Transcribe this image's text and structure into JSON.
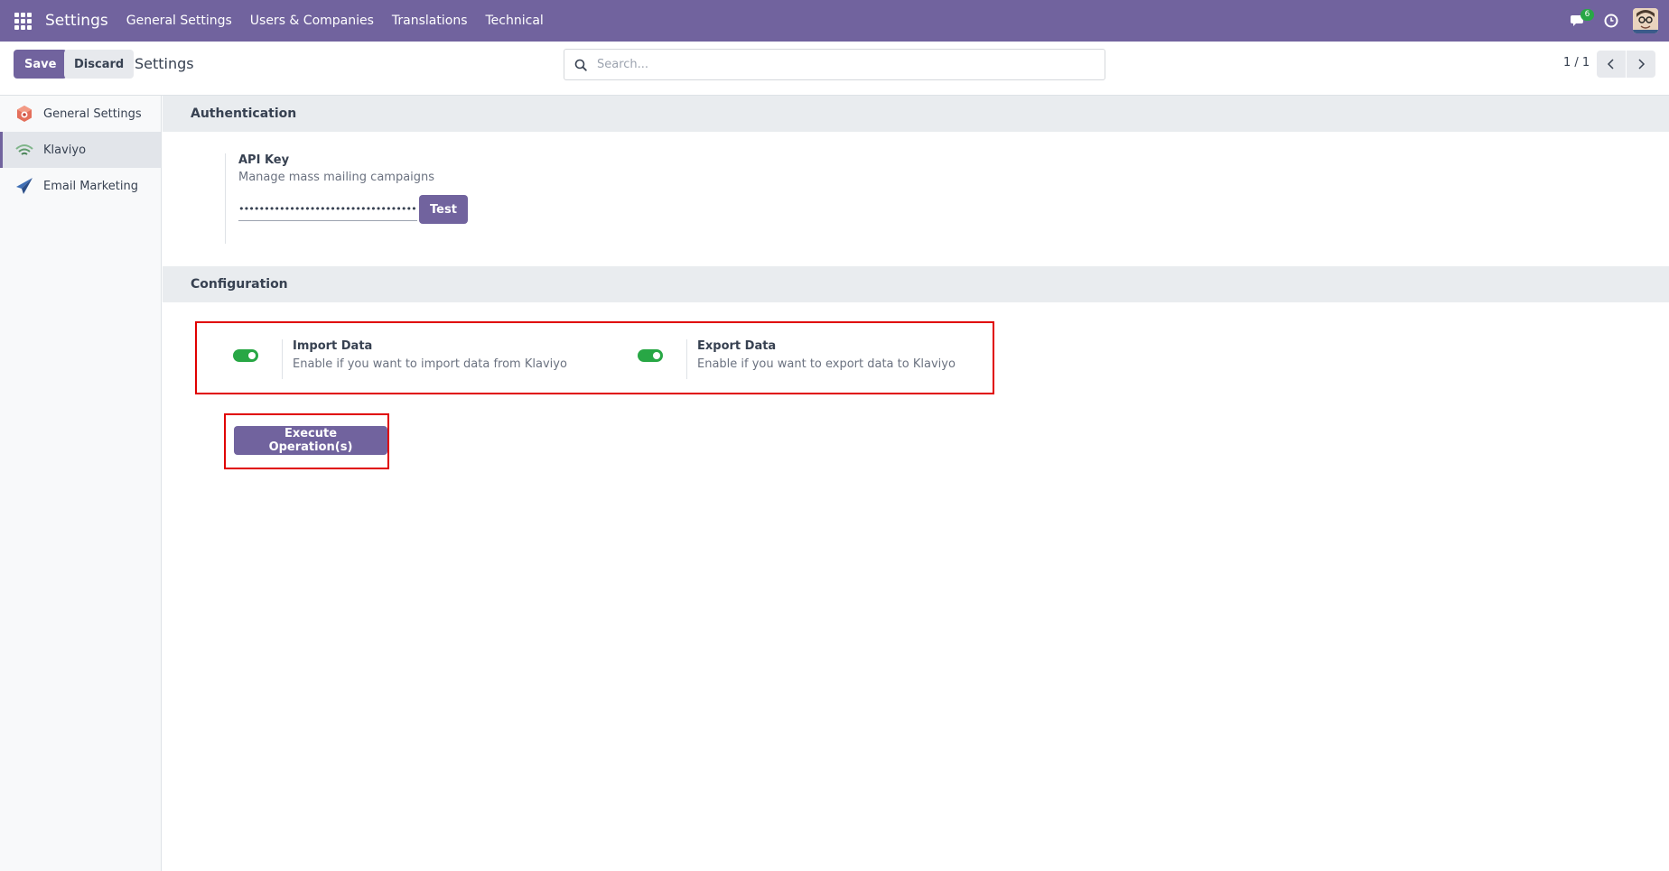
{
  "navbar": {
    "brand": "Settings",
    "menu": [
      "General Settings",
      "Users & Companies",
      "Translations",
      "Technical"
    ],
    "chat_count": "6"
  },
  "control_panel": {
    "save_label": "Save",
    "discard_label": "Discard",
    "title": "Settings",
    "search_placeholder": "Search...",
    "pager": "1 / 1"
  },
  "sidebar": {
    "items": [
      {
        "label": "General Settings",
        "icon": "general-settings-icon",
        "active": false
      },
      {
        "label": "Klaviyo",
        "icon": "klaviyo-icon",
        "active": true
      },
      {
        "label": "Email Marketing",
        "icon": "email-marketing-icon",
        "active": false
      }
    ]
  },
  "authentication": {
    "title": "Authentication",
    "api_key_label": "API Key",
    "api_key_desc": "Manage mass mailing campaigns",
    "api_key_value": "••••••••••••••••••••••••••••••••••••••",
    "test_label": "Test"
  },
  "configuration": {
    "title": "Configuration",
    "import": {
      "label": "Import Data",
      "desc": "Enable if you want to import data from Klaviyo",
      "enabled": true
    },
    "export": {
      "label": "Export Data",
      "desc": "Enable if you want to export data to Klaviyo",
      "enabled": true
    },
    "execute_label": "Execute Operation(s)"
  },
  "colors": {
    "primary": "#71639e",
    "toggle_on": "#28a745",
    "highlight": "#e00000"
  }
}
